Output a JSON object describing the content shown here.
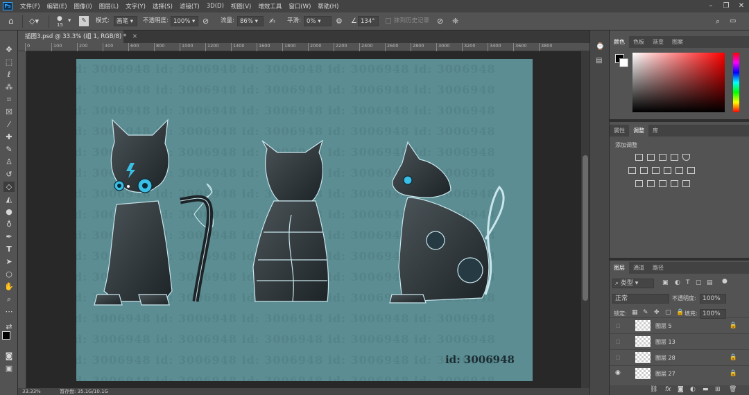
{
  "app": {
    "logo": "Ps",
    "menus": [
      "文件(F)",
      "编辑(E)",
      "图像(I)",
      "图层(L)",
      "文字(Y)",
      "选择(S)",
      "滤镜(T)",
      "3D(D)",
      "视图(V)",
      "增效工具",
      "窗口(W)",
      "帮助(H)"
    ]
  },
  "options": {
    "brush_size": "15",
    "mode_label": "模式:",
    "mode_value": "画笔",
    "opacity_label": "不透明度:",
    "opacity_value": "100%",
    "flow_label": "流量:",
    "flow_value": "86%",
    "smoothing_label": "平滑:",
    "smoothing_value": "0%",
    "angle_value": "134°",
    "history_label": "抹到历史记录"
  },
  "document": {
    "tab_title": "插图3.psd @ 33.3% (组 1, RGB/8) *",
    "ruler_ticks": [
      "0",
      "100",
      "200",
      "400",
      "600",
      "800",
      "1000",
      "1200",
      "1400",
      "1600",
      "1800",
      "2000",
      "2200",
      "2400",
      "2600",
      "2800",
      "3000",
      "3200",
      "3400",
      "3600",
      "3800"
    ],
    "watermark_text": "id: 3006948",
    "corner_id": "id: 3006948"
  },
  "status": {
    "zoom": "33.33%",
    "scratch": "暂存盘: 35.1G/10.1G"
  },
  "color_panel": {
    "tabs": [
      "颜色",
      "色板",
      "渐变",
      "图案"
    ]
  },
  "adjust_panel": {
    "tabs": [
      "属性",
      "调整",
      "库"
    ],
    "heading": "添加调整"
  },
  "layers_panel": {
    "tabs": [
      "图层",
      "通道",
      "路径"
    ],
    "filter_label": "类型",
    "blend_mode": "正常",
    "opacity_label": "不透明度:",
    "opacity_value": "100%",
    "lock_label": "锁定:",
    "fill_label": "填充:",
    "fill_value": "100%",
    "layers": [
      {
        "name": "图层 5",
        "visible": false,
        "locked": true
      },
      {
        "name": "图层 13",
        "visible": false,
        "locked": false
      },
      {
        "name": "图层 28",
        "visible": false,
        "locked": true
      },
      {
        "name": "图层 27",
        "visible": true,
        "locked": true
      }
    ]
  }
}
